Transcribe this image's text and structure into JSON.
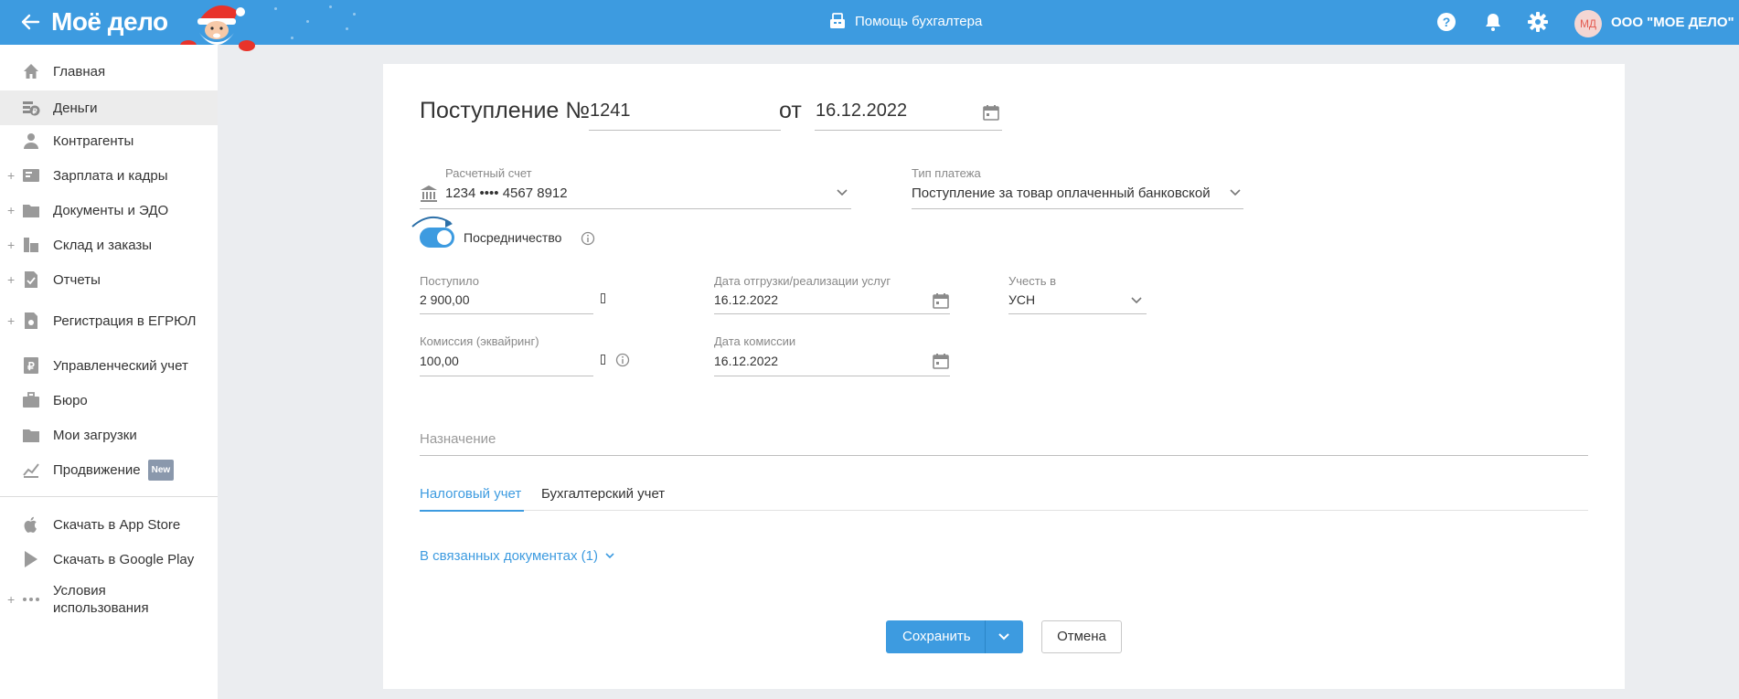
{
  "header": {
    "logo": "Моё дело",
    "help_center": "Помощь бухгалтера",
    "avatar_initials": "МД",
    "organization": "ООО \"МОЕ ДЕЛО\""
  },
  "sidebar": {
    "items": [
      {
        "label": "Главная",
        "icon": "home-icon",
        "expandable": false
      },
      {
        "label": "Деньги",
        "icon": "money-icon",
        "expandable": false,
        "active": true
      },
      {
        "label": "Контрагенты",
        "icon": "contractors-icon",
        "expandable": false
      },
      {
        "label": "Зарплата и кадры",
        "icon": "salary-icon",
        "expandable": true
      },
      {
        "label": "Документы и ЭДО",
        "icon": "documents-icon",
        "expandable": true
      },
      {
        "label": "Склад и заказы",
        "icon": "warehouse-icon",
        "expandable": true
      },
      {
        "label": "Отчеты",
        "icon": "reports-icon",
        "expandable": true
      },
      {
        "label": "Регистрация в ЕГРЮЛ",
        "icon": "registration-icon",
        "expandable": true
      },
      {
        "label": "Управленческий учет",
        "icon": "management-icon",
        "expandable": false
      },
      {
        "label": "Бюро",
        "icon": "bureau-icon",
        "expandable": false
      },
      {
        "label": "Мои загрузки",
        "icon": "downloads-icon",
        "expandable": false
      },
      {
        "label": "Продвижение",
        "icon": "promotion-icon",
        "expandable": false,
        "badge": "New"
      },
      {
        "label": "Скачать в App Store",
        "icon": "apple-icon",
        "expandable": false
      },
      {
        "label": "Скачать в Google Play",
        "icon": "google-play-icon",
        "expandable": false
      },
      {
        "label": "Условия использования",
        "icon": "more-icon",
        "expandable": true
      }
    ]
  },
  "form": {
    "title": "Поступление №",
    "number": "1241",
    "date_prefix": "от",
    "date": "16.12.2022",
    "account": {
      "label": "Расчетный счет",
      "value": "1234 •••• 4567 8912"
    },
    "payment_type": {
      "label": "Тип платежа",
      "value": "Поступление за товар оплаченный банковской"
    },
    "mediation": {
      "label": "Посредничество",
      "enabled": true
    },
    "received": {
      "label": "Поступило",
      "value": "2 900,00"
    },
    "shipment_date": {
      "label": "Дата отгрузки/реализации услуг",
      "value": "16.12.2022"
    },
    "account_in": {
      "label": "Учесть в",
      "value": "УСН"
    },
    "commission": {
      "label": "Комиссия (эквайринг)",
      "value": "100,00"
    },
    "commission_date": {
      "label": "Дата комиссии",
      "value": "16.12.2022"
    },
    "purpose": {
      "placeholder": "Назначение"
    },
    "tabs": [
      {
        "label": "Налоговый учет",
        "active": true
      },
      {
        "label": "Бухгалтерский учет",
        "active": false
      }
    ],
    "linked_docs": "В связанных документах (1)",
    "save_label": "Сохранить",
    "cancel_label": "Отмена"
  },
  "colors": {
    "accent": "#3d9be0",
    "avatar_text": "#e35c52"
  }
}
